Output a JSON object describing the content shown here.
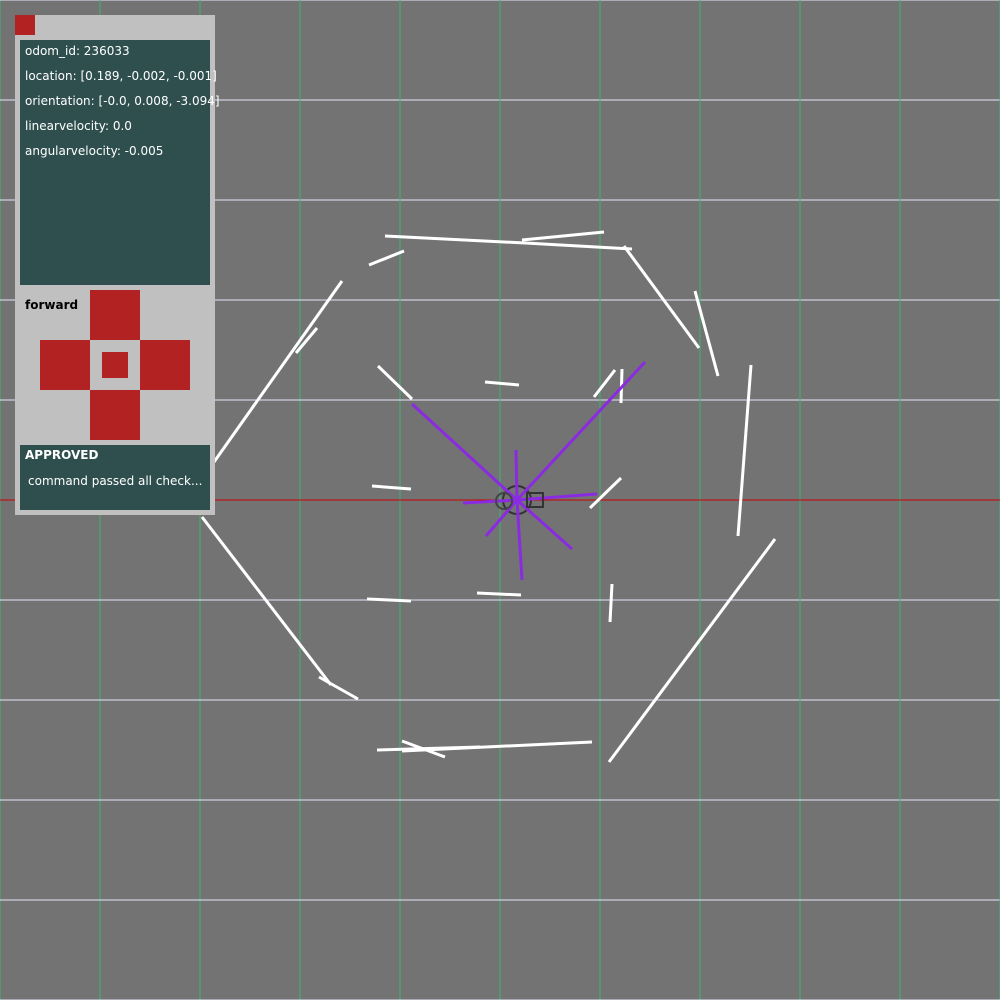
{
  "colors": {
    "background": "#737373",
    "grid_vertical": "#3cb371",
    "grid_horizontal": "#e6e6fa",
    "axis_line": "#cc0000",
    "scan_wall": "#ffffff",
    "robot_rays": "#8a2be2",
    "panel": "#c0c0c0",
    "panel_dark": "#2f4f4f",
    "control_red": "#b22222"
  },
  "odometry": {
    "odom_id": "odom_id: 236033",
    "location": "location: [0.189, -0.002, -0.001]",
    "orientation": "orientation: [-0.0, 0.008, -3.094]",
    "linear_velocity": "linearvelocity: 0.0",
    "angular_velocity": "angularvelocity: -0.005"
  },
  "controls": {
    "command_label": "forward",
    "icons": [
      "up-arrow-button",
      "left-arrow-button",
      "stop-button",
      "right-arrow-button",
      "down-arrow-button"
    ]
  },
  "status": {
    "title": "APPROVED",
    "message": "command passed all check..."
  }
}
